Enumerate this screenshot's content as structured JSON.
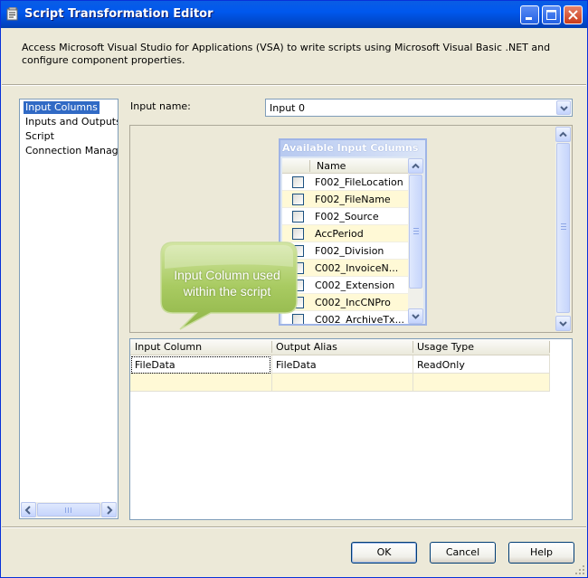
{
  "window": {
    "title": "Script Transformation Editor"
  },
  "description": "Access Microsoft Visual Studio for Applications (VSA) to write scripts using Microsoft Visual Basic .NET and configure component properties.",
  "nav": {
    "items": [
      {
        "label": "Input Columns",
        "selected": true
      },
      {
        "label": "Inputs and Outputs",
        "selected": false
      },
      {
        "label": "Script",
        "selected": false
      },
      {
        "label": "Connection Managers",
        "selected": false
      }
    ]
  },
  "input_name": {
    "label": "Input name:",
    "value": "Input 0"
  },
  "available_columns": {
    "title": "Available Input Columns",
    "header_name": "Name",
    "rows": [
      {
        "name": "F002_FileLocation",
        "checked": false
      },
      {
        "name": "F002_FileName",
        "checked": false
      },
      {
        "name": "F002_Source",
        "checked": false
      },
      {
        "name": "AccPeriod",
        "checked": false
      },
      {
        "name": "F002_Division",
        "checked": false
      },
      {
        "name": "C002_InvoiceN...",
        "checked": false
      },
      {
        "name": "C002_Extension",
        "checked": false
      },
      {
        "name": "C002_IncCNPro",
        "checked": false
      },
      {
        "name": "C002_ArchiveTx...",
        "checked": false
      }
    ]
  },
  "callout": {
    "text": "Input Column used within the script"
  },
  "mapping_grid": {
    "headers": [
      "Input Column",
      "Output Alias",
      "Usage Type"
    ],
    "rows": [
      {
        "input_column": "FileData",
        "output_alias": "FileData",
        "usage_type": "ReadOnly"
      }
    ]
  },
  "buttons": {
    "ok": "OK",
    "cancel": "Cancel",
    "help": "Help"
  },
  "colors": {
    "titlebar": "#0058ee",
    "selection": "#316ac5",
    "callout_green": "#a7c95f",
    "highlight_row": "#fff9d6"
  }
}
